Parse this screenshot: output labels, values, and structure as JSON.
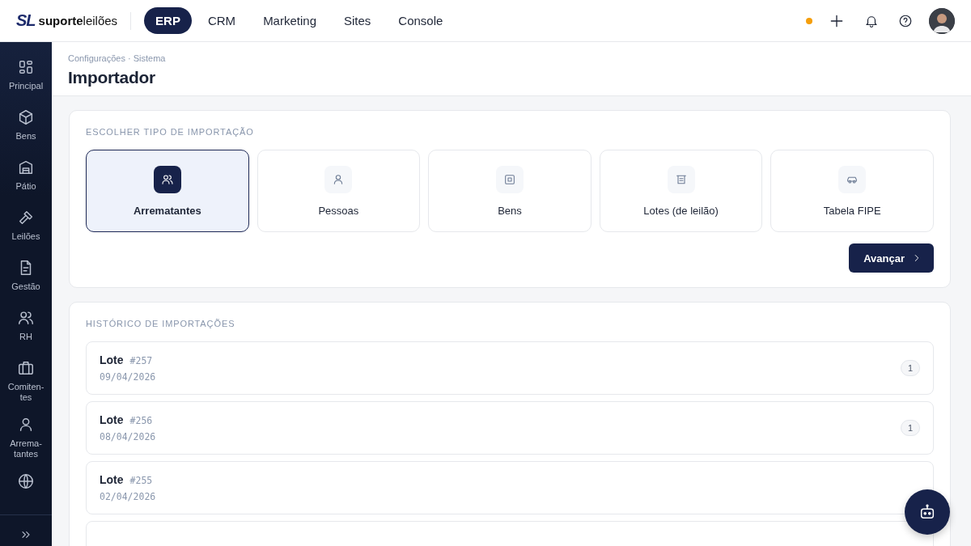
{
  "topbar": {
    "logo": {
      "mark": "SL",
      "word_bold": "suporte",
      "word_light": "leilões"
    },
    "modules": [
      {
        "label": "ERP",
        "selected": true
      },
      {
        "label": "CRM",
        "selected": false
      },
      {
        "label": "Marketing",
        "selected": false
      },
      {
        "label": "Sites",
        "selected": false
      },
      {
        "label": "Console",
        "selected": false
      }
    ],
    "status_dot": {
      "color": "#f59e0b"
    }
  },
  "sidebar": {
    "items": [
      {
        "kind": "grid",
        "label": "Principal"
      },
      {
        "kind": "box",
        "label": "Bens"
      },
      {
        "kind": "garage",
        "label": "Pátio"
      },
      {
        "kind": "gavel",
        "label": "Leilões"
      },
      {
        "kind": "doc",
        "label": "Gestão"
      },
      {
        "kind": "users",
        "label": "RH"
      },
      {
        "kind": "briefcase",
        "label": "Comiten-tes"
      },
      {
        "kind": "user",
        "label": "Arrema-tantes"
      },
      {
        "kind": "globe"
      }
    ]
  },
  "page": {
    "breadcrumb": "Configurações · Sistema",
    "title": "Importador"
  },
  "import_types": {
    "heading": "ESCOLHER TIPO DE IMPORTAÇÃO",
    "options": [
      {
        "kind": "users",
        "label": "Arrematantes",
        "selected": true
      },
      {
        "kind": "user",
        "label": "Pessoas",
        "selected": false
      },
      {
        "kind": "square",
        "label": "Bens",
        "selected": false
      },
      {
        "kind": "archive",
        "label": "Lotes (de leilão)",
        "selected": false
      },
      {
        "kind": "car",
        "label": "Tabela FIPE",
        "selected": false
      }
    ],
    "next_button": "Avançar"
  },
  "history": {
    "heading": "HISTÓRICO DE IMPORTAÇÕES",
    "rows": [
      {
        "title": "Lote",
        "number": "#257",
        "date": "09/04/2026",
        "count": "1"
      },
      {
        "title": "Lote",
        "number": "#256",
        "date": "08/04/2026",
        "count": "1"
      },
      {
        "title": "Lote",
        "number": "#255",
        "date": "02/04/2026"
      },
      {}
    ]
  }
}
